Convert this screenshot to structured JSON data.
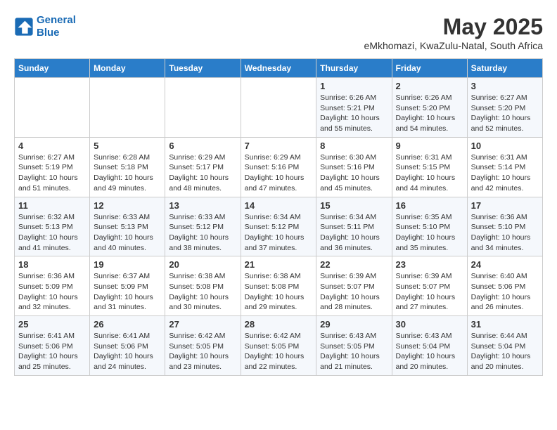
{
  "logo": {
    "line1": "General",
    "line2": "Blue"
  },
  "title": "May 2025",
  "subtitle": "eMkhomazi, KwaZulu-Natal, South Africa",
  "headers": [
    "Sunday",
    "Monday",
    "Tuesday",
    "Wednesday",
    "Thursday",
    "Friday",
    "Saturday"
  ],
  "weeks": [
    [
      {
        "day": "",
        "info": ""
      },
      {
        "day": "",
        "info": ""
      },
      {
        "day": "",
        "info": ""
      },
      {
        "day": "",
        "info": ""
      },
      {
        "day": "1",
        "info": "Sunrise: 6:26 AM\nSunset: 5:21 PM\nDaylight: 10 hours\nand 55 minutes."
      },
      {
        "day": "2",
        "info": "Sunrise: 6:26 AM\nSunset: 5:20 PM\nDaylight: 10 hours\nand 54 minutes."
      },
      {
        "day": "3",
        "info": "Sunrise: 6:27 AM\nSunset: 5:20 PM\nDaylight: 10 hours\nand 52 minutes."
      }
    ],
    [
      {
        "day": "4",
        "info": "Sunrise: 6:27 AM\nSunset: 5:19 PM\nDaylight: 10 hours\nand 51 minutes."
      },
      {
        "day": "5",
        "info": "Sunrise: 6:28 AM\nSunset: 5:18 PM\nDaylight: 10 hours\nand 49 minutes."
      },
      {
        "day": "6",
        "info": "Sunrise: 6:29 AM\nSunset: 5:17 PM\nDaylight: 10 hours\nand 48 minutes."
      },
      {
        "day": "7",
        "info": "Sunrise: 6:29 AM\nSunset: 5:16 PM\nDaylight: 10 hours\nand 47 minutes."
      },
      {
        "day": "8",
        "info": "Sunrise: 6:30 AM\nSunset: 5:16 PM\nDaylight: 10 hours\nand 45 minutes."
      },
      {
        "day": "9",
        "info": "Sunrise: 6:31 AM\nSunset: 5:15 PM\nDaylight: 10 hours\nand 44 minutes."
      },
      {
        "day": "10",
        "info": "Sunrise: 6:31 AM\nSunset: 5:14 PM\nDaylight: 10 hours\nand 42 minutes."
      }
    ],
    [
      {
        "day": "11",
        "info": "Sunrise: 6:32 AM\nSunset: 5:13 PM\nDaylight: 10 hours\nand 41 minutes."
      },
      {
        "day": "12",
        "info": "Sunrise: 6:33 AM\nSunset: 5:13 PM\nDaylight: 10 hours\nand 40 minutes."
      },
      {
        "day": "13",
        "info": "Sunrise: 6:33 AM\nSunset: 5:12 PM\nDaylight: 10 hours\nand 38 minutes."
      },
      {
        "day": "14",
        "info": "Sunrise: 6:34 AM\nSunset: 5:12 PM\nDaylight: 10 hours\nand 37 minutes."
      },
      {
        "day": "15",
        "info": "Sunrise: 6:34 AM\nSunset: 5:11 PM\nDaylight: 10 hours\nand 36 minutes."
      },
      {
        "day": "16",
        "info": "Sunrise: 6:35 AM\nSunset: 5:10 PM\nDaylight: 10 hours\nand 35 minutes."
      },
      {
        "day": "17",
        "info": "Sunrise: 6:36 AM\nSunset: 5:10 PM\nDaylight: 10 hours\nand 34 minutes."
      }
    ],
    [
      {
        "day": "18",
        "info": "Sunrise: 6:36 AM\nSunset: 5:09 PM\nDaylight: 10 hours\nand 32 minutes."
      },
      {
        "day": "19",
        "info": "Sunrise: 6:37 AM\nSunset: 5:09 PM\nDaylight: 10 hours\nand 31 minutes."
      },
      {
        "day": "20",
        "info": "Sunrise: 6:38 AM\nSunset: 5:08 PM\nDaylight: 10 hours\nand 30 minutes."
      },
      {
        "day": "21",
        "info": "Sunrise: 6:38 AM\nSunset: 5:08 PM\nDaylight: 10 hours\nand 29 minutes."
      },
      {
        "day": "22",
        "info": "Sunrise: 6:39 AM\nSunset: 5:07 PM\nDaylight: 10 hours\nand 28 minutes."
      },
      {
        "day": "23",
        "info": "Sunrise: 6:39 AM\nSunset: 5:07 PM\nDaylight: 10 hours\nand 27 minutes."
      },
      {
        "day": "24",
        "info": "Sunrise: 6:40 AM\nSunset: 5:06 PM\nDaylight: 10 hours\nand 26 minutes."
      }
    ],
    [
      {
        "day": "25",
        "info": "Sunrise: 6:41 AM\nSunset: 5:06 PM\nDaylight: 10 hours\nand 25 minutes."
      },
      {
        "day": "26",
        "info": "Sunrise: 6:41 AM\nSunset: 5:06 PM\nDaylight: 10 hours\nand 24 minutes."
      },
      {
        "day": "27",
        "info": "Sunrise: 6:42 AM\nSunset: 5:05 PM\nDaylight: 10 hours\nand 23 minutes."
      },
      {
        "day": "28",
        "info": "Sunrise: 6:42 AM\nSunset: 5:05 PM\nDaylight: 10 hours\nand 22 minutes."
      },
      {
        "day": "29",
        "info": "Sunrise: 6:43 AM\nSunset: 5:05 PM\nDaylight: 10 hours\nand 21 minutes."
      },
      {
        "day": "30",
        "info": "Sunrise: 6:43 AM\nSunset: 5:04 PM\nDaylight: 10 hours\nand 20 minutes."
      },
      {
        "day": "31",
        "info": "Sunrise: 6:44 AM\nSunset: 5:04 PM\nDaylight: 10 hours\nand 20 minutes."
      }
    ]
  ]
}
